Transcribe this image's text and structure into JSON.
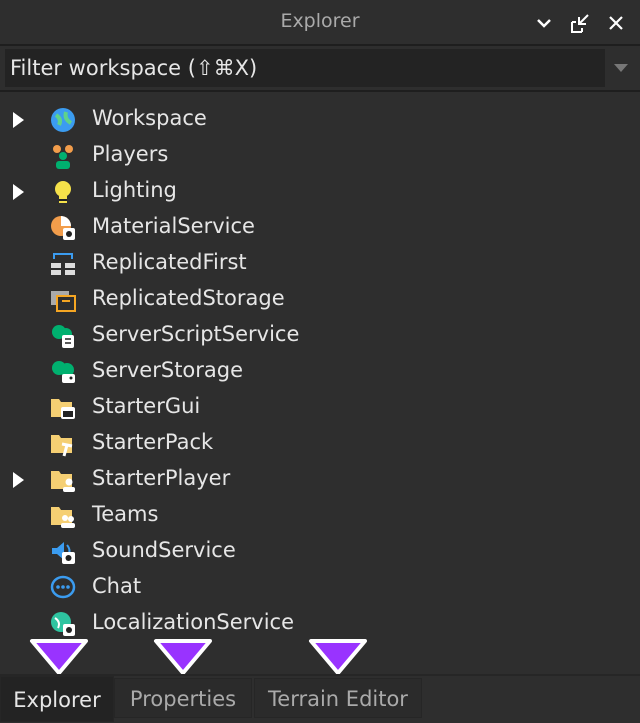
{
  "window": {
    "title": "Explorer"
  },
  "filter": {
    "placeholder": "Filter workspace (⇧⌘X)"
  },
  "tree": [
    {
      "label": "Workspace",
      "icon": "workspace-icon",
      "expandable": true
    },
    {
      "label": "Players",
      "icon": "players-icon",
      "expandable": false
    },
    {
      "label": "Lighting",
      "icon": "lighting-icon",
      "expandable": true
    },
    {
      "label": "MaterialService",
      "icon": "material-service-icon",
      "expandable": false
    },
    {
      "label": "ReplicatedFirst",
      "icon": "replicated-first-icon",
      "expandable": false
    },
    {
      "label": "ReplicatedStorage",
      "icon": "replicated-storage-icon",
      "expandable": false
    },
    {
      "label": "ServerScriptService",
      "icon": "server-script-service-icon",
      "expandable": false
    },
    {
      "label": "ServerStorage",
      "icon": "server-storage-icon",
      "expandable": false
    },
    {
      "label": "StarterGui",
      "icon": "starter-gui-icon",
      "expandable": false
    },
    {
      "label": "StarterPack",
      "icon": "starter-pack-icon",
      "expandable": false
    },
    {
      "label": "StarterPlayer",
      "icon": "starter-player-icon",
      "expandable": true
    },
    {
      "label": "Teams",
      "icon": "teams-icon",
      "expandable": false
    },
    {
      "label": "SoundService",
      "icon": "sound-service-icon",
      "expandable": false
    },
    {
      "label": "Chat",
      "icon": "chat-icon",
      "expandable": false
    },
    {
      "label": "LocalizationService",
      "icon": "localization-service-icon",
      "expandable": false
    }
  ],
  "tabs": [
    {
      "label": "Explorer",
      "active": true
    },
    {
      "label": "Properties",
      "active": false
    },
    {
      "label": "Terrain Editor",
      "active": false
    }
  ],
  "colors": {
    "marker": "#9933ff",
    "folder": "#f5cf73",
    "green": "#00b06f",
    "blue": "#3b9cf0"
  }
}
